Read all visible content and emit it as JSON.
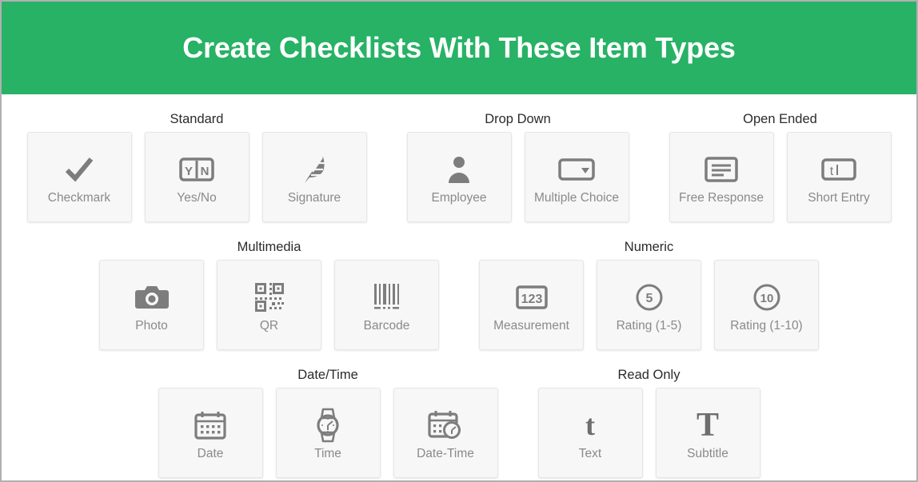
{
  "header": {
    "title": "Create Checklists With These Item Types",
    "background_color": "#27b265",
    "text_color": "#ffffff"
  },
  "theme": {
    "card_background": "#f7f7f7",
    "card_border": "#e6e6e6",
    "icon_color": "#7d7d7d",
    "label_color": "#8a8a8a",
    "group_label_color": "#2b2b2b",
    "page_border": "#b0b0b0"
  },
  "rows": [
    {
      "groups": [
        {
          "label": "Standard",
          "items": [
            {
              "label": "Checkmark",
              "icon": "checkmark-icon"
            },
            {
              "label": "Yes/No",
              "icon": "yes-no-icon",
              "glyph_left": "Y",
              "glyph_right": "N"
            },
            {
              "label": "Signature",
              "icon": "feather-signature-icon"
            }
          ]
        },
        {
          "label": "Drop Down",
          "items": [
            {
              "label": "Employee",
              "icon": "person-icon"
            },
            {
              "label": "Multiple Choice",
              "icon": "dropdown-box-icon"
            }
          ]
        },
        {
          "label": "Open Ended",
          "items": [
            {
              "label": "Free Response",
              "icon": "text-lines-box-icon"
            },
            {
              "label": "Short Entry",
              "icon": "text-field-cursor-icon",
              "glyph": "t"
            }
          ]
        }
      ]
    },
    {
      "groups": [
        {
          "label": "Multimedia",
          "items": [
            {
              "label": "Photo",
              "icon": "camera-icon"
            },
            {
              "label": "QR",
              "icon": "qr-code-icon"
            },
            {
              "label": "Barcode",
              "icon": "barcode-icon"
            }
          ]
        },
        {
          "label": "Numeric",
          "items": [
            {
              "label": "Measurement",
              "icon": "number-box-icon",
              "glyph": "123"
            },
            {
              "label": "Rating (1-5)",
              "icon": "circle-number-icon",
              "glyph": "5"
            },
            {
              "label": "Rating (1-10)",
              "icon": "circle-number-icon",
              "glyph": "10"
            }
          ]
        }
      ]
    },
    {
      "groups": [
        {
          "label": "Date/Time",
          "items": [
            {
              "label": "Date",
              "icon": "calendar-icon"
            },
            {
              "label": "Time",
              "icon": "watch-icon"
            },
            {
              "label": "Date-Time",
              "icon": "calendar-clock-icon"
            }
          ]
        },
        {
          "label": "Read Only",
          "items": [
            {
              "label": "Text",
              "icon": "lowercase-t-icon",
              "glyph": "t"
            },
            {
              "label": "Subtitle",
              "icon": "uppercase-t-icon",
              "glyph": "T"
            }
          ]
        }
      ]
    }
  ]
}
